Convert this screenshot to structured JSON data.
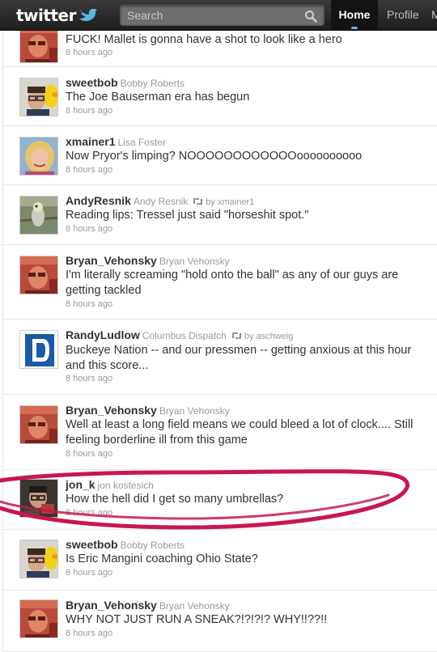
{
  "header": {
    "logo_text": "twitter",
    "search_placeholder": "Search",
    "nav": {
      "home": "Home",
      "profile": "Profile",
      "more": "M"
    }
  },
  "colors": {
    "accent": "#59b7e8",
    "highlight_ring": "#c8174d",
    "topbar": "#2a2a2a"
  },
  "tweets": [
    {
      "screen_name": "",
      "full_name": "",
      "retweeted_by": "",
      "text": "FUCK! Mallet is gonna have a shot to look like a hero",
      "time": "8 hours ago",
      "avatar_icon": "avatar-red-tint"
    },
    {
      "screen_name": "sweetbob",
      "full_name": "Bobby Roberts",
      "retweeted_by": "",
      "text": "The Joe Bauserman era has begun",
      "time": "8 hours ago",
      "avatar_icon": "avatar-duck"
    },
    {
      "screen_name": "xmainer1",
      "full_name": "Lisa Foster",
      "retweeted_by": "",
      "text": "Now Pryor's limping? NOOOOOOOOOOOOoooooooooo",
      "time": "8 hours ago",
      "avatar_icon": "avatar-blonde"
    },
    {
      "screen_name": "AndyResnik",
      "full_name": "Andy Resnik",
      "retweeted_by": "by xmainer1",
      "text": "Reading lips: Tressel just said \"horseshit spot.\"",
      "time": "8 hours ago",
      "avatar_icon": "avatar-bird"
    },
    {
      "screen_name": "Bryan_Vehonsky",
      "full_name": "Bryan Vehonsky",
      "retweeted_by": "",
      "text": "I'm literally screaming \"hold onto the ball\" as any of our guys are getting tackled",
      "time": "8 hours ago",
      "avatar_icon": "avatar-red-tint"
    },
    {
      "screen_name": "RandyLudlow",
      "full_name": "Columbus Dispatch",
      "retweeted_by": "by aschweig",
      "text": "Buckeye Nation -- and our pressmen -- getting anxious at this hour and this score...",
      "time": "8 hours ago",
      "avatar_icon": "avatar-dispatch-logo"
    },
    {
      "screen_name": "Bryan_Vehonsky",
      "full_name": "Bryan Vehonsky",
      "retweeted_by": "",
      "text": "Well at least a long field means we could bleed a lot of clock.... Still feeling borderline ill from this game",
      "time": "8 hours ago",
      "avatar_icon": "avatar-red-tint"
    },
    {
      "screen_name": "jon_k",
      "full_name": "jon kostesich",
      "retweeted_by": "",
      "text": "How the hell did I get so many umbrellas?",
      "time": "8 hours ago",
      "avatar_icon": "avatar-umbrellas"
    },
    {
      "screen_name": "sweetbob",
      "full_name": "Bobby Roberts",
      "retweeted_by": "",
      "text": "Is Eric Mangini coaching Ohio State?",
      "time": "8 hours ago",
      "avatar_icon": "avatar-duck"
    },
    {
      "screen_name": "Bryan_Vehonsky",
      "full_name": "Bryan Vehonsky",
      "retweeted_by": "",
      "text": "WHY NOT JUST RUN A SNEAK?!?!?!? WHY!!??!!",
      "time": "8 hours ago",
      "avatar_icon": "avatar-red-tint"
    }
  ]
}
